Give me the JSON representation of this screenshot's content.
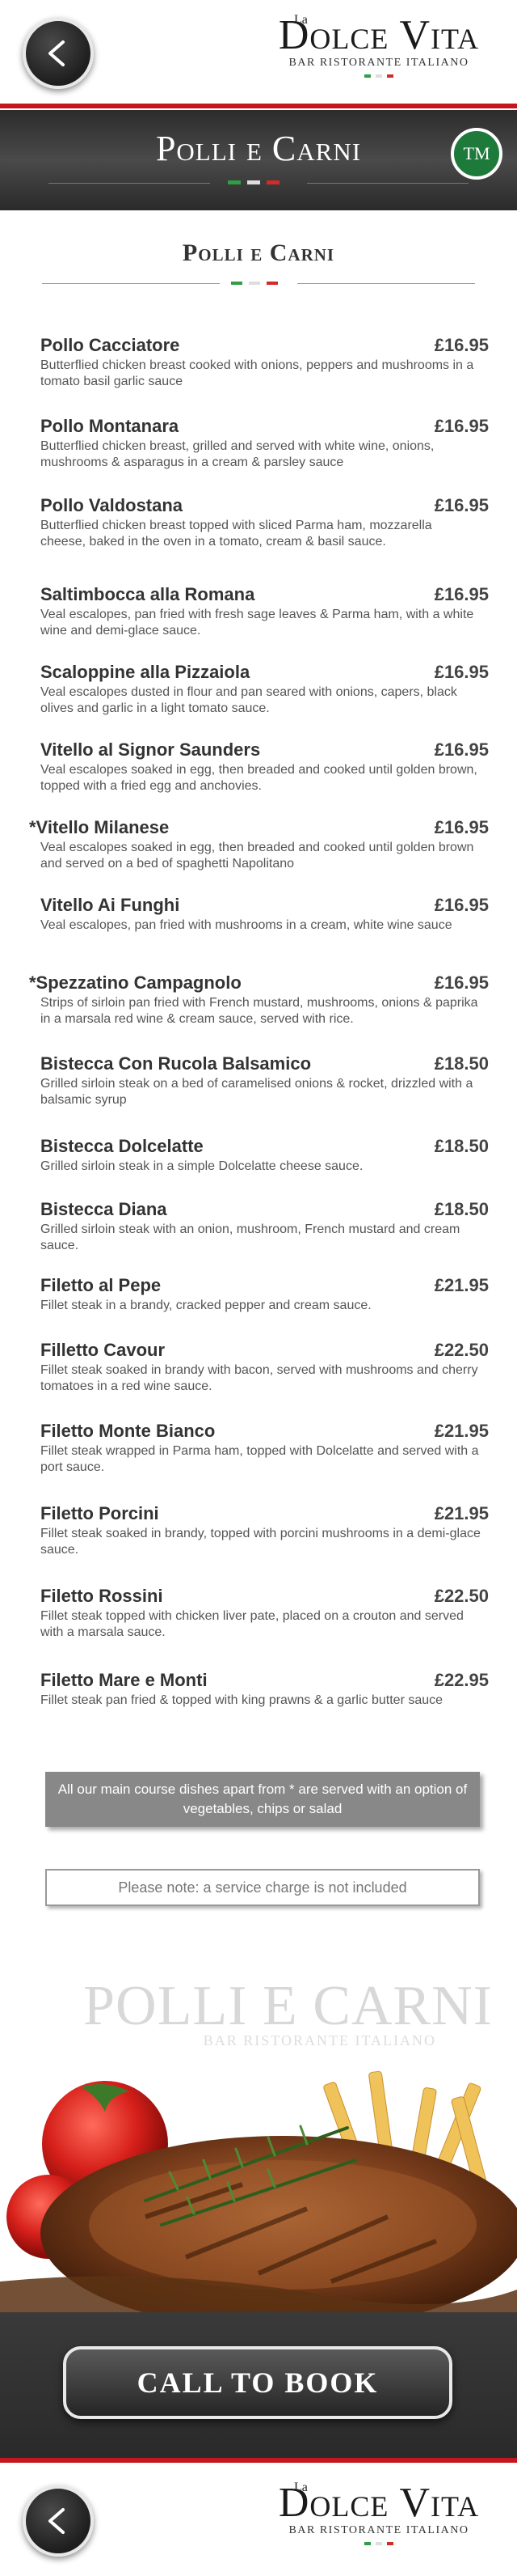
{
  "header": {
    "back_label": "<",
    "logo": {
      "la": "La",
      "main": "Dolce Vita",
      "sub": "BAR RISTORANTE ITALIANO"
    }
  },
  "banner": {
    "title": "Polli e Carni",
    "badge": "TM"
  },
  "section": {
    "heading": "Polli e Carni"
  },
  "menu_items": [
    {
      "name": "Pollo Cacciatore",
      "price": "£16.95",
      "desc": "Butterflied chicken breast cooked with onions, peppers and mushrooms in a tomato basil garlic sauce"
    },
    {
      "name": "Pollo Montanara",
      "price": "£16.95",
      "desc": "Butterflied chicken breast, grilled and served with white wine, onions, mushrooms & asparagus in a cream & parsley sauce"
    },
    {
      "name": "Pollo Valdostana",
      "price": "£16.95",
      "desc": "Butterflied chicken breast topped with sliced Parma ham, mozzarella cheese, baked in the oven in a tomato, cream & basil sauce."
    },
    {
      "name": "Saltimbocca alla Romana",
      "price": "£16.95",
      "desc": "Veal escalopes, pan fried with fresh sage leaves & Parma ham, with a white wine and demi-glace sauce."
    },
    {
      "name": "Scaloppine alla Pizzaiola",
      "price": "£16.95",
      "desc": "Veal escalopes dusted in flour and pan seared with onions, capers, black olives and garlic in a light tomato sauce."
    },
    {
      "name": "Vitello al Signor Saunders",
      "price": "£16.95",
      "desc": "Veal escalopes soaked in egg, then breaded and cooked until golden brown, topped with a fried egg and anchovies."
    },
    {
      "name": "*Vitello Milanese",
      "price": "£16.95",
      "desc": "Veal escalopes soaked in egg, then breaded and cooked until golden brown and served on a bed of spaghetti Napolitano"
    },
    {
      "name": "Vitello Ai Funghi",
      "price": "£16.95",
      "desc": "Veal escalopes, pan fried with mushrooms in a cream, white wine sauce"
    },
    {
      "name": "*Spezzatino Campagnolo",
      "price": "£16.95",
      "desc": "Strips of sirloin pan fried with French mustard, mushrooms, onions & paprika in a marsala red wine & cream sauce, served with rice."
    },
    {
      "name": "Bistecca Con Rucola Balsamico",
      "price": "£18.50",
      "desc": "Grilled sirloin steak on a bed of caramelised onions & rocket, drizzled with a balsamic syrup"
    },
    {
      "name": "Bistecca Dolcelatte",
      "price": "£18.50",
      "desc": "Grilled sirloin steak in a simple Dolcelatte cheese sauce."
    },
    {
      "name": "Bistecca Diana",
      "price": "£18.50",
      "desc": "Grilled sirloin steak with an onion, mushroom, French mustard and cream sauce."
    },
    {
      "name": "Filetto al Pepe",
      "price": "£21.95",
      "desc": "Fillet steak in a brandy, cracked pepper and cream sauce."
    },
    {
      "name": "Filletto Cavour",
      "price": "£22.50",
      "desc": "Fillet steak soaked in brandy with bacon, served with mushrooms and cherry tomatoes in a red wine sauce."
    },
    {
      "name": "Filetto Monte Bianco",
      "price": "£21.95",
      "desc": "Fillet steak wrapped in Parma ham, topped with Dolcelatte and served with a port sauce."
    },
    {
      "name": "Filetto Porcini",
      "price": "£21.95",
      "desc": "Fillet steak soaked in brandy, topped with porcini mushrooms in a demi-glace sauce."
    },
    {
      "name": "Filetto Rossini",
      "price": "£22.50",
      "desc": "Fillet steak topped with chicken liver pate, placed on a crouton and served with a marsala sauce."
    },
    {
      "name": "Filetto Mare e Monti",
      "price": "£22.95",
      "desc": "Fillet steak pan fried & topped with king prawns & a garlic butter sauce"
    }
  ],
  "notes": {
    "main_course": "All our main course dishes apart from * are served with an option of vegetables, chips or salad",
    "service": "Please note: a service charge is not included"
  },
  "food": {
    "watermark": "POLLI E CARNI",
    "watermark_sub": "BAR RISTORANTE ITALIANO"
  },
  "cta": {
    "label": "CALL TO BOOK"
  },
  "footer": {
    "back_label": "<",
    "logo": {
      "la": "La",
      "main": "Dolce Vita",
      "sub": "BAR RISTORANTE ITALIANO"
    }
  },
  "colors": {
    "accent_red": "#c4161c",
    "badge_green": "#1e7a3a",
    "flag_green": "#2f9e44",
    "flag_red": "#d42a2a"
  }
}
